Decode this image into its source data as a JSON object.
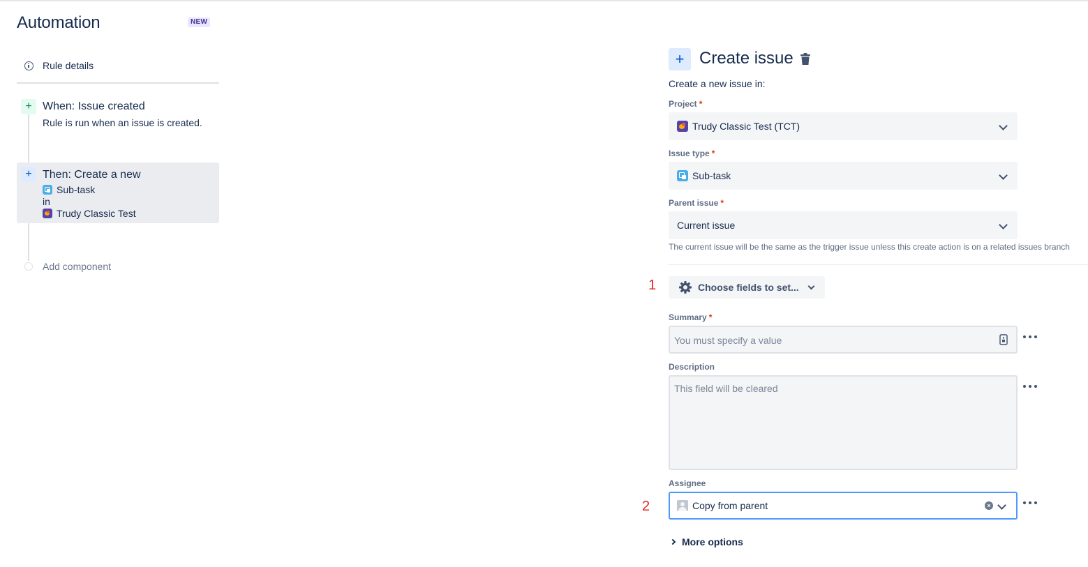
{
  "sidebar": {
    "title": "Automation",
    "badge": "NEW",
    "rule_details": "Rule details",
    "trigger": {
      "title": "When: Issue created",
      "subtitle": "Rule is run when an issue is created."
    },
    "action": {
      "title": "Then: Create a new",
      "issue_type": "Sub-task",
      "connector": "in",
      "project": "Trudy Classic Test"
    },
    "add_component": "Add component"
  },
  "panel": {
    "title": "Create issue",
    "intro": "Create a new issue in:",
    "project": {
      "label": "Project",
      "value": "Trudy Classic Test (TCT)"
    },
    "issue_type": {
      "label": "Issue type",
      "value": "Sub-task"
    },
    "parent_issue": {
      "label": "Parent issue",
      "value": "Current issue",
      "helper": "The current issue will be the same as the trigger issue unless this create action is on a related issues branch"
    },
    "choose_fields": "Choose fields to set...",
    "summary": {
      "label": "Summary",
      "placeholder": "You must specify a value"
    },
    "description": {
      "label": "Description",
      "placeholder": "This field will be cleared"
    },
    "assignee": {
      "label": "Assignee",
      "value": "Copy from parent"
    },
    "more_options": "More options"
  },
  "annotations": {
    "one": "1",
    "two": "2"
  },
  "required_marker": "*",
  "colors": {
    "text": "#172b4d",
    "subtle": "#5e6c84",
    "required": "#de350b",
    "focus": "#4c9aff",
    "annotation": "#e3251c",
    "field_bg": "#f4f5f7"
  },
  "icons": [
    "info-icon",
    "plus-icon",
    "trash-icon",
    "project-icon",
    "subtask-icon",
    "chevron-down-icon",
    "gear-icon",
    "more-icon",
    "clear-icon",
    "avatar-icon",
    "chevron-right-icon",
    "field-picker-icon"
  ]
}
